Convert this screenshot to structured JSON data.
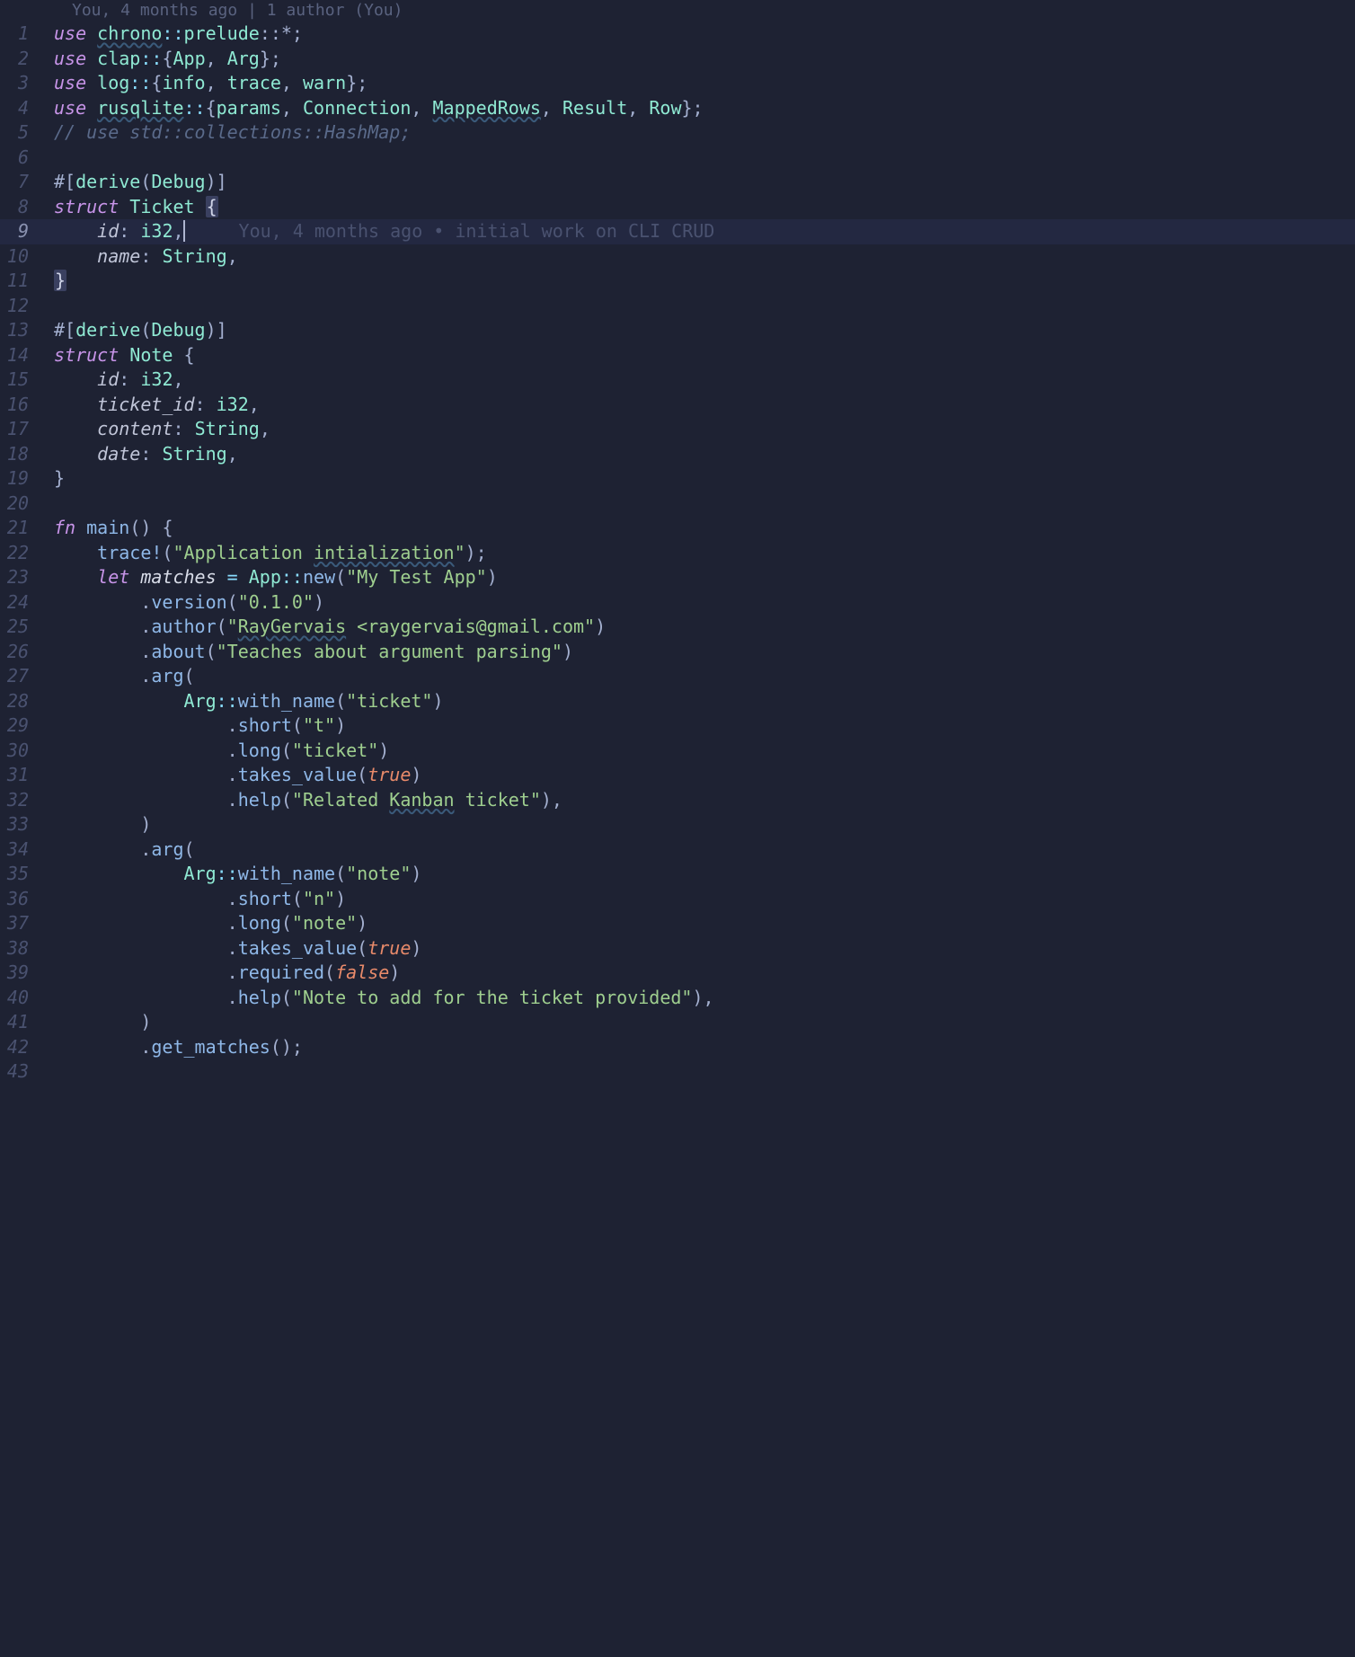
{
  "blame_header": "You, 4 months ago | 1 author (You)",
  "blame_inline": "You, 4 months ago • initial work on CLI CRUD",
  "current_line": 9,
  "lines": {
    "l1": {
      "use": "use",
      "mod": "chrono",
      "sep": "::",
      "sub": "prelude",
      "tail": "::*;"
    },
    "l2": {
      "use": "use",
      "mod": "clap",
      "sep": "::",
      "open": "{",
      "i1": "App",
      "c": ", ",
      "i2": "Arg",
      "close": "};"
    },
    "l3": {
      "use": "use",
      "mod": "log",
      "sep": "::",
      "open": "{",
      "i1": "info",
      "c": ", ",
      "i2": "trace",
      "c2": ", ",
      "i3": "warn",
      "close": "};"
    },
    "l4": {
      "use": "use",
      "mod": "rusqlite",
      "sep": "::",
      "open": "{",
      "i1": "params",
      "c": ", ",
      "i2": "Connection",
      "c2": ", ",
      "i3": "MappedRows",
      "c3": ", ",
      "i4": "Result",
      "c4": ", ",
      "i5": "Row",
      "close": "};"
    },
    "l5": {
      "comment": "// use std::collections::HashMap;"
    },
    "l7": {
      "text": "#[derive(Debug)]",
      "open": "#[",
      "fn": "derive",
      "p1": "(",
      "ty": "Debug",
      "p2": ")]"
    },
    "l8": {
      "kw": "struct",
      "name": "Ticket",
      "brace": "{"
    },
    "l9": {
      "field": "id",
      "colon": ": ",
      "ty": "i32",
      "comma": ","
    },
    "l10": {
      "field": "name",
      "colon": ": ",
      "ty": "String",
      "comma": ","
    },
    "l11": {
      "brace": "}"
    },
    "l13": {
      "open": "#[",
      "fn": "derive",
      "p1": "(",
      "ty": "Debug",
      "p2": ")]"
    },
    "l14": {
      "kw": "struct",
      "name": "Note",
      "brace": "{"
    },
    "l15": {
      "field": "id",
      "colon": ": ",
      "ty": "i32",
      "comma": ","
    },
    "l16": {
      "field": "ticket_id",
      "colon": ": ",
      "ty": "i32",
      "comma": ","
    },
    "l17": {
      "field": "content",
      "colon": ": ",
      "ty": "String",
      "comma": ","
    },
    "l18": {
      "field": "date",
      "colon": ": ",
      "ty": "String",
      "comma": ","
    },
    "l19": {
      "brace": "}"
    },
    "l21": {
      "kw": "fn",
      "name": "main",
      "paren": "()",
      "brace": " {"
    },
    "l22": {
      "macro": "trace!",
      "p1": "(",
      "str": "\"Application ",
      "str_u": "intialization",
      "str2": "\"",
      "p2": ");"
    },
    "l23": {
      "kw": "let",
      "var": "matches",
      "eq": " = ",
      "ty": "App",
      "sep": "::",
      "fn": "new",
      "p1": "(",
      "str": "\"My Test App\"",
      "p2": ")"
    },
    "l24": {
      "dot": ".",
      "fn": "version",
      "p1": "(",
      "str": "\"0.1.0\"",
      "p2": ")"
    },
    "l25": {
      "dot": ".",
      "fn": "author",
      "p1": "(",
      "str1": "\"",
      "str_u": "RayGervais",
      "str2": " <raygervais@gmail.com\"",
      "p2": ")"
    },
    "l26": {
      "dot": ".",
      "fn": "about",
      "p1": "(",
      "str": "\"Teaches about argument parsing\"",
      "p2": ")"
    },
    "l27": {
      "dot": ".",
      "fn": "arg",
      "p1": "("
    },
    "l28": {
      "ty": "Arg",
      "sep": "::",
      "fn": "with_name",
      "p1": "(",
      "str": "\"ticket\"",
      "p2": ")"
    },
    "l29": {
      "dot": ".",
      "fn": "short",
      "p1": "(",
      "str": "\"t\"",
      "p2": ")"
    },
    "l30": {
      "dot": ".",
      "fn": "long",
      "p1": "(",
      "str": "\"ticket\"",
      "p2": ")"
    },
    "l31": {
      "dot": ".",
      "fn": "takes_value",
      "p1": "(",
      "bool": "true",
      "p2": ")"
    },
    "l32": {
      "dot": ".",
      "fn": "help",
      "p1": "(",
      "str1": "\"Related ",
      "str_u": "Kanban",
      "str2": " ticket\"",
      "p2": "),"
    },
    "l33": {
      "p": ")"
    },
    "l34": {
      "dot": ".",
      "fn": "arg",
      "p1": "("
    },
    "l35": {
      "ty": "Arg",
      "sep": "::",
      "fn": "with_name",
      "p1": "(",
      "str": "\"note\"",
      "p2": ")"
    },
    "l36": {
      "dot": ".",
      "fn": "short",
      "p1": "(",
      "str": "\"n\"",
      "p2": ")"
    },
    "l37": {
      "dot": ".",
      "fn": "long",
      "p1": "(",
      "str": "\"note\"",
      "p2": ")"
    },
    "l38": {
      "dot": ".",
      "fn": "takes_value",
      "p1": "(",
      "bool": "true",
      "p2": ")"
    },
    "l39": {
      "dot": ".",
      "fn": "required",
      "p1": "(",
      "bool": "false",
      "p2": ")"
    },
    "l40": {
      "dot": ".",
      "fn": "help",
      "p1": "(",
      "str": "\"Note to add for the ticket provided\"",
      "p2": "),"
    },
    "l41": {
      "p": ")"
    },
    "l42": {
      "dot": ".",
      "fn": "get_matches",
      "p1": "();"
    }
  },
  "line_numbers": [
    "1",
    "2",
    "3",
    "4",
    "5",
    "6",
    "7",
    "8",
    "9",
    "10",
    "11",
    "12",
    "13",
    "14",
    "15",
    "16",
    "17",
    "18",
    "19",
    "20",
    "21",
    "22",
    "23",
    "24",
    "25",
    "26",
    "27",
    "28",
    "29",
    "30",
    "31",
    "32",
    "33",
    "34",
    "35",
    "36",
    "37",
    "38",
    "39",
    "40",
    "41",
    "42",
    "43"
  ]
}
